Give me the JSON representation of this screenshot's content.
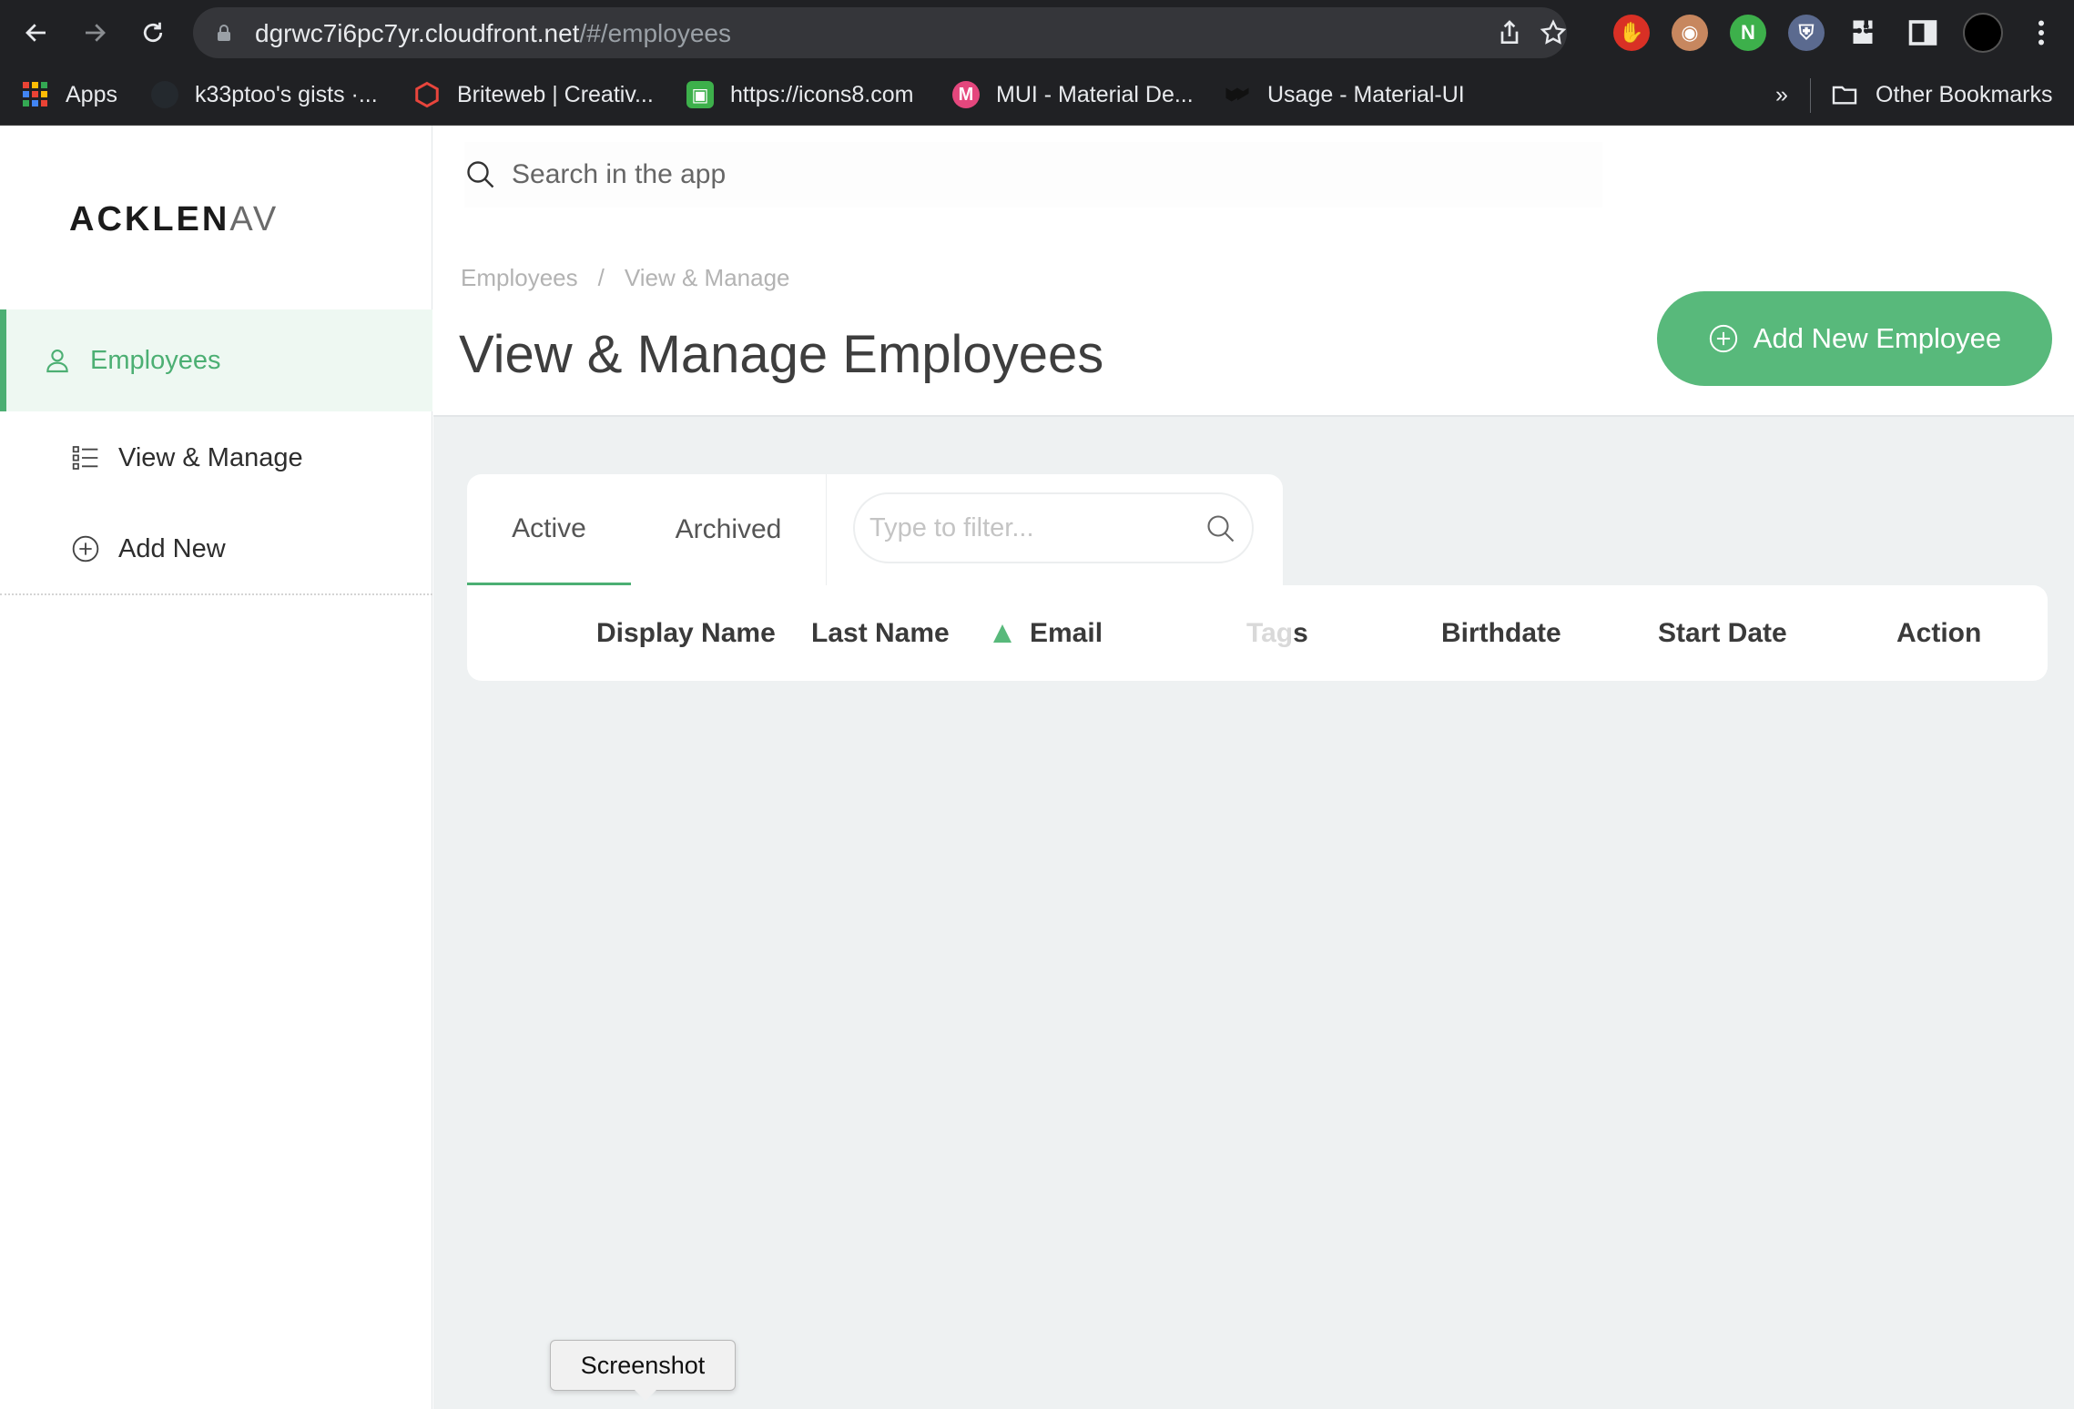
{
  "browser": {
    "url_host": "dgrwc7i6pc7yr.cloudfront.net",
    "url_path": "/#/employees",
    "bookmarks": [
      {
        "label": "Apps",
        "icon": "apps-grid-icon",
        "color": "#e8453c"
      },
      {
        "label": "k33ptoo's gists ·...",
        "icon": "github-icon",
        "color": "#24292e"
      },
      {
        "label": "Briteweb | Creativ...",
        "icon": "briteweb-icon",
        "color": "#e8453c"
      },
      {
        "label": "https://icons8.com",
        "icon": "icons8-icon",
        "color": "#3db04b"
      },
      {
        "label": "MUI - Material De...",
        "icon": "mui-icon",
        "color": "#e4477d"
      },
      {
        "label": "Usage - Material-UI",
        "icon": "material-ui-icon",
        "color": "#111111"
      }
    ],
    "overflow_label": "»",
    "other_bookmarks": "Other Bookmarks",
    "extensions": [
      {
        "name": "adblock-icon",
        "color": "#d93025",
        "glyph": "✋"
      },
      {
        "name": "reader-glasses-icon",
        "color": "#c7875f",
        "glyph": "◉"
      },
      {
        "name": "nordvpn-icon",
        "color": "#3db04b",
        "glyph": "N"
      },
      {
        "name": "shield-extension-icon",
        "color": "#9aa7c7",
        "glyph": "⛨"
      }
    ]
  },
  "sidebar": {
    "logo_main": "ACKLEN",
    "logo_tail": "AV",
    "items": [
      {
        "label": "Employees",
        "icon": "user-icon",
        "active": true
      },
      {
        "label": "View & Manage",
        "icon": "list-icon",
        "active": false
      },
      {
        "label": "Add New",
        "icon": "plus-circle-icon",
        "active": false
      }
    ]
  },
  "header": {
    "search_placeholder": "Search in the app",
    "breadcrumb": [
      "Employees",
      "View & Manage"
    ],
    "breadcrumb_separator": "/",
    "title": "View & Manage Employees",
    "add_button_label": "Add New Employee",
    "accent_color": "#58b97b"
  },
  "tabs": {
    "items": [
      {
        "label": "Active",
        "selected": true
      },
      {
        "label": "Archived",
        "selected": false
      }
    ],
    "filter_placeholder": "Type to filter..."
  },
  "table": {
    "columns": [
      "Display Name",
      "Last Name",
      "Email",
      "Tags",
      "Birthdate",
      "Start Date",
      "Action"
    ],
    "sorted_column": "Email",
    "sort_direction": "ascending",
    "tags_faded_part": "Tag",
    "tags_visible_part": "s",
    "rows": []
  },
  "tooltip": {
    "label": "Screenshot"
  }
}
